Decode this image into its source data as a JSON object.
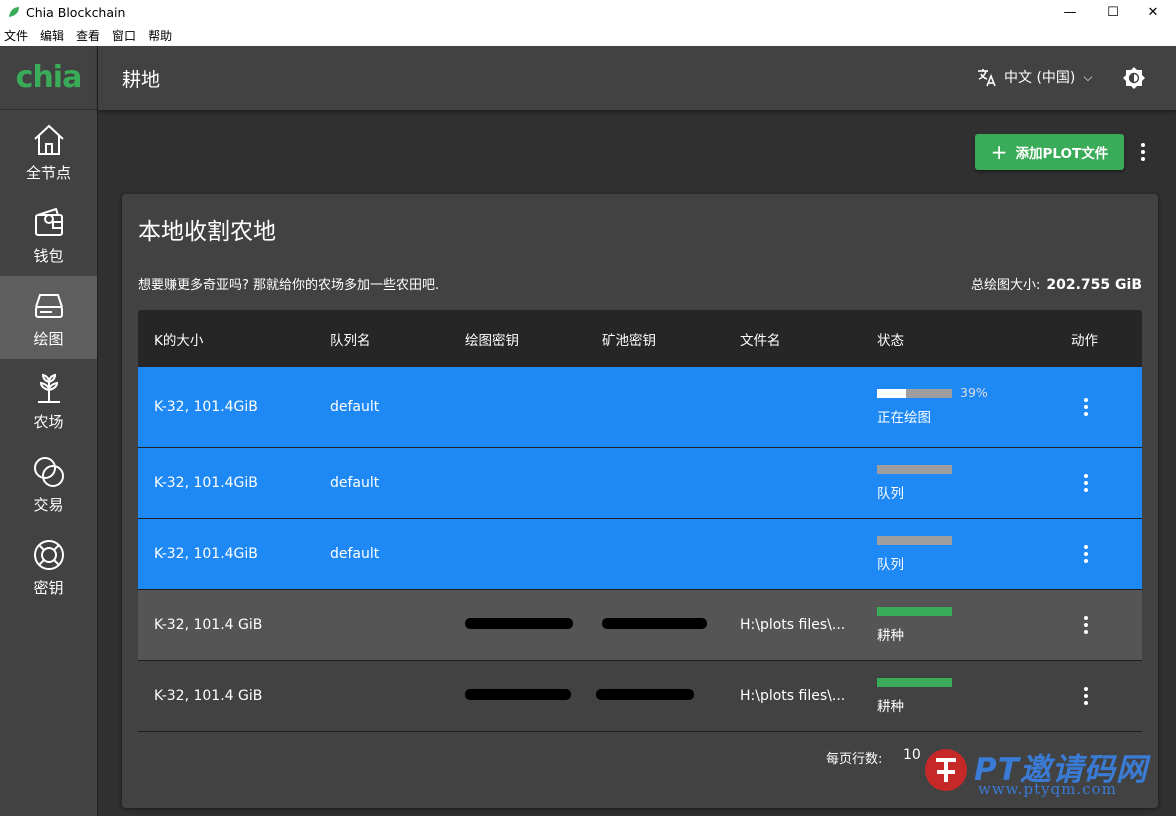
{
  "window": {
    "title": "Chia Blockchain",
    "min": "—",
    "max": "☐",
    "close": "✕"
  },
  "menu": [
    "文件",
    "编辑",
    "查看",
    "窗口",
    "帮助"
  ],
  "logo": "chia",
  "nav": [
    {
      "label": "全节点",
      "icon": "home-icon"
    },
    {
      "label": "钱包",
      "icon": "wallet-icon"
    },
    {
      "label": "绘图",
      "icon": "drive-icon",
      "active": true
    },
    {
      "label": "农场",
      "icon": "sprout-icon"
    },
    {
      "label": "交易",
      "icon": "trade-icon"
    },
    {
      "label": "密钥",
      "icon": "key-lifebuoy-icon"
    }
  ],
  "header": {
    "title": "耕地",
    "language": "中文 (中国)"
  },
  "add_button": "添加PLOT文件",
  "card": {
    "title": "本地收割农地",
    "hint": "想要赚更多奇亚吗? 那就给你的农场多加一些农田吧.",
    "total_label": "总绘图大小:",
    "total_value": "202.755 GiB"
  },
  "table": {
    "headers": [
      "K的大小",
      "队列名",
      "绘图密钥",
      "矿池密钥",
      "文件名",
      "状态",
      "动作"
    ],
    "rows": [
      {
        "k": "K-32, 101.4GiB",
        "queue": "default",
        "status": "正在绘图",
        "progress": 0.39,
        "progress_text": "39%"
      },
      {
        "k": "K-32, 101.4GiB",
        "queue": "default",
        "status": "队列"
      },
      {
        "k": "K-32, 101.4GiB",
        "queue": "default",
        "status": "队列"
      },
      {
        "k": "K-32, 101.4 GiB",
        "file": "H:\\plots files\\...",
        "status": "耕种"
      },
      {
        "k": "K-32, 101.4 GiB",
        "file": "H:\\plots files\\...",
        "status": "耕种"
      }
    ]
  },
  "pager": {
    "rows_label": "每页行数:",
    "rows_value": "10"
  },
  "watermark": {
    "text": "PT邀请码网",
    "url": "www.ptyqm.com"
  },
  "colors": {
    "accent": "#3aac59",
    "blue_row": "#1e88f5",
    "dark": "#303030"
  }
}
